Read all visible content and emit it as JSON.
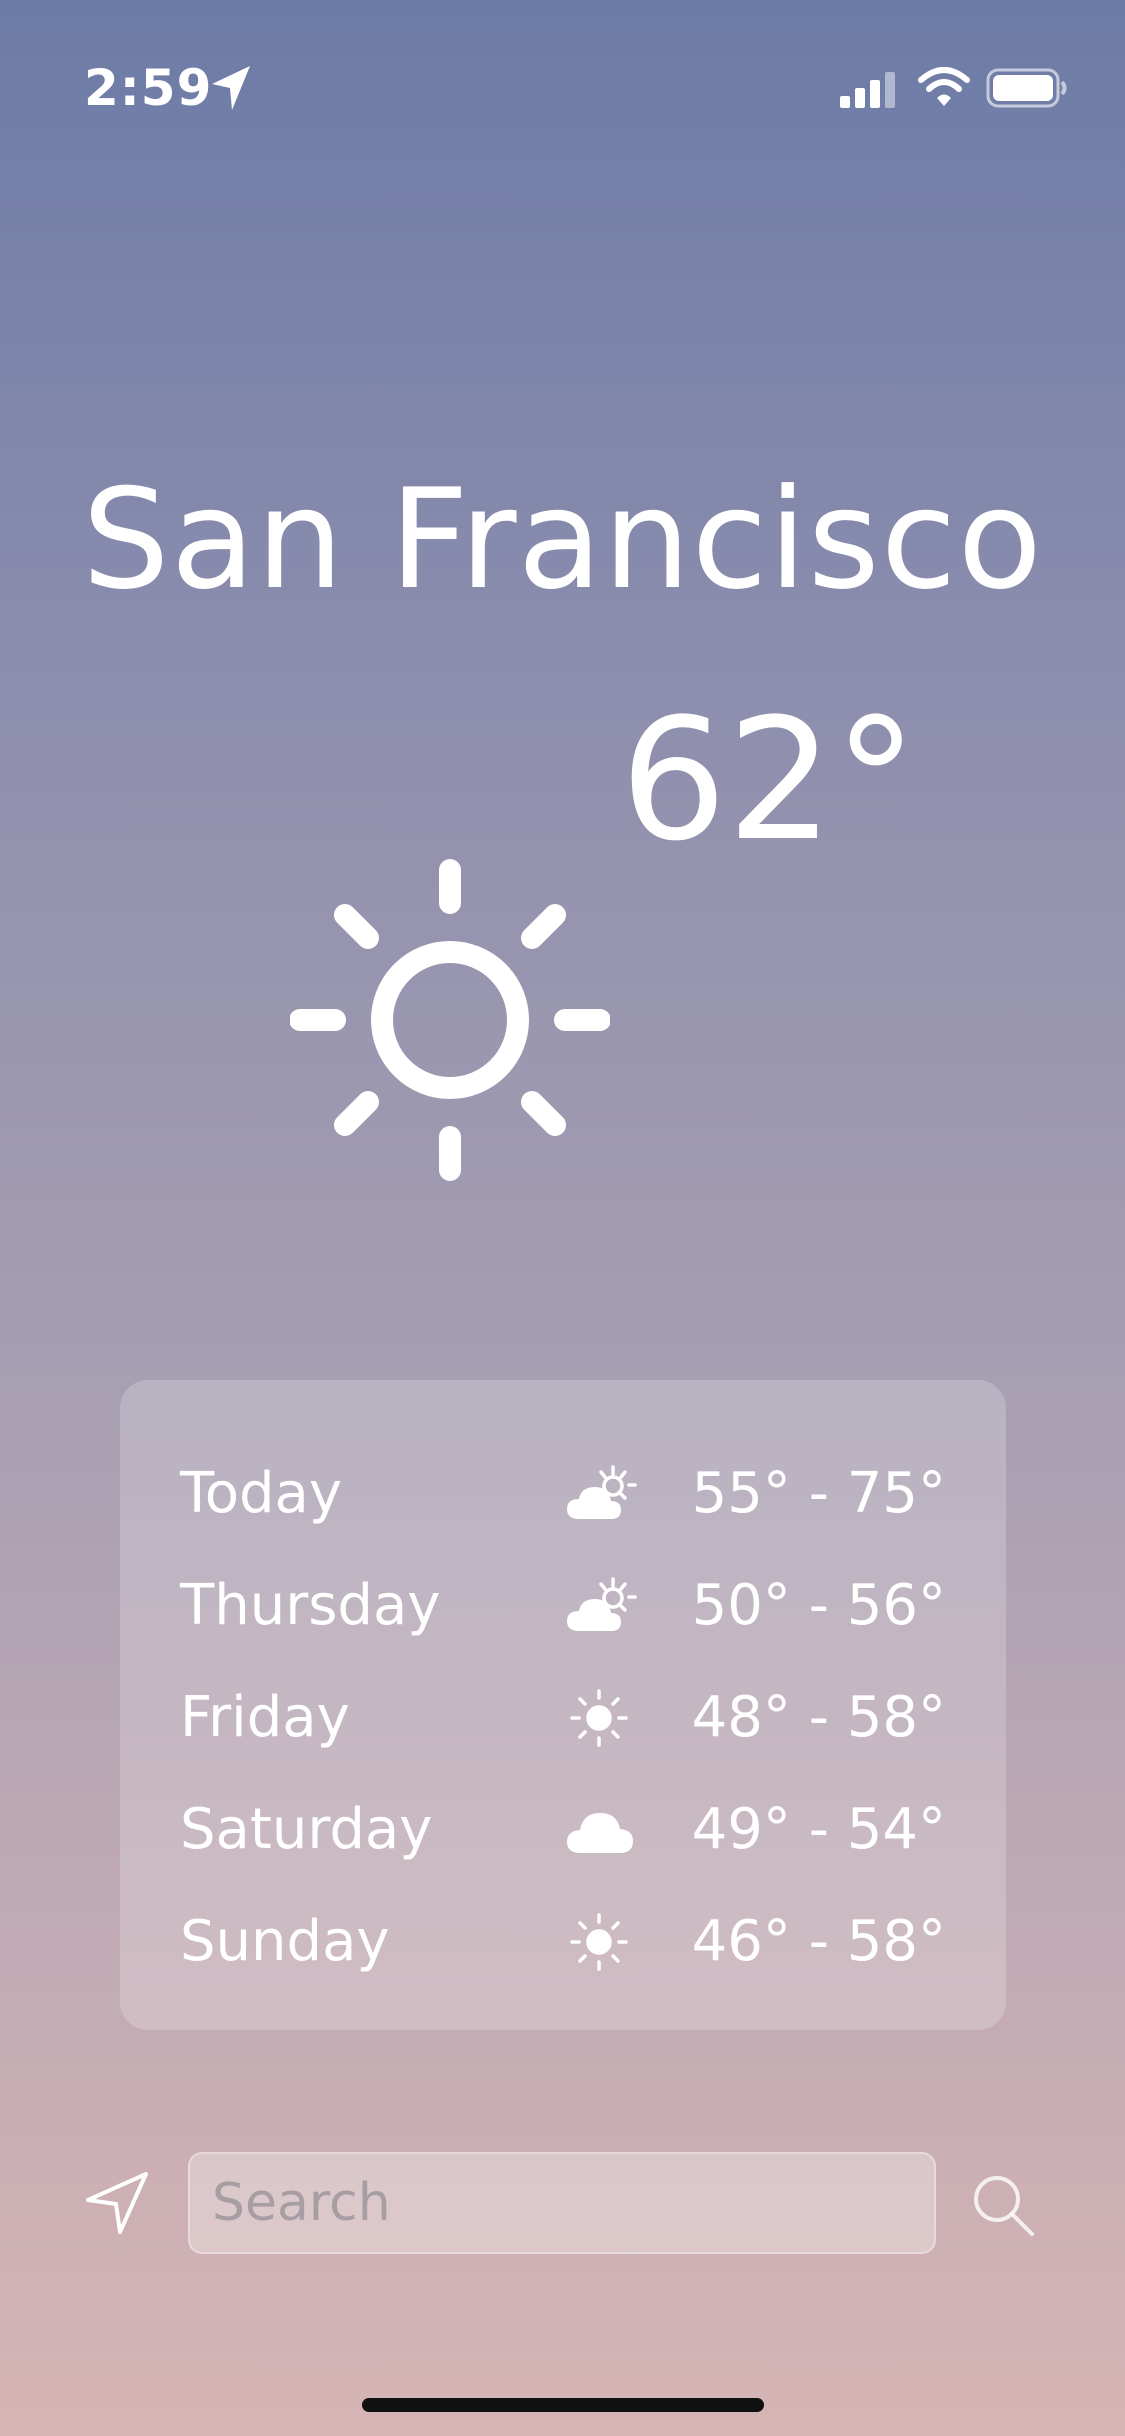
{
  "status_bar": {
    "time": "2:59",
    "location_icon": "location-arrow-icon",
    "signal_icon": "cellular-signal-icon",
    "wifi_icon": "wifi-icon",
    "battery_icon": "battery-icon"
  },
  "weather": {
    "city": "San Francisco",
    "temperature": "62°",
    "condition_icon": "sun-icon"
  },
  "forecast": [
    {
      "day": "Today",
      "icon": "partly-cloudy-icon",
      "range": "55° - 75°"
    },
    {
      "day": "Thursday",
      "icon": "partly-cloudy-icon",
      "range": "50° - 56°"
    },
    {
      "day": "Friday",
      "icon": "sun-icon",
      "range": "48° - 58°"
    },
    {
      "day": "Saturday",
      "icon": "cloud-icon",
      "range": "49° - 54°"
    },
    {
      "day": "Sunday",
      "icon": "sun-icon",
      "range": "46° - 58°"
    }
  ],
  "search": {
    "placeholder": "Search",
    "location_button_icon": "location-arrow-outline-icon",
    "search_button_icon": "magnifier-icon"
  },
  "colors": {
    "gradient_top": "#6c7ba6",
    "gradient_bottom": "#d6b5b5",
    "text": "#ffffff",
    "card": "rgba(255,255,255,0.2)"
  }
}
